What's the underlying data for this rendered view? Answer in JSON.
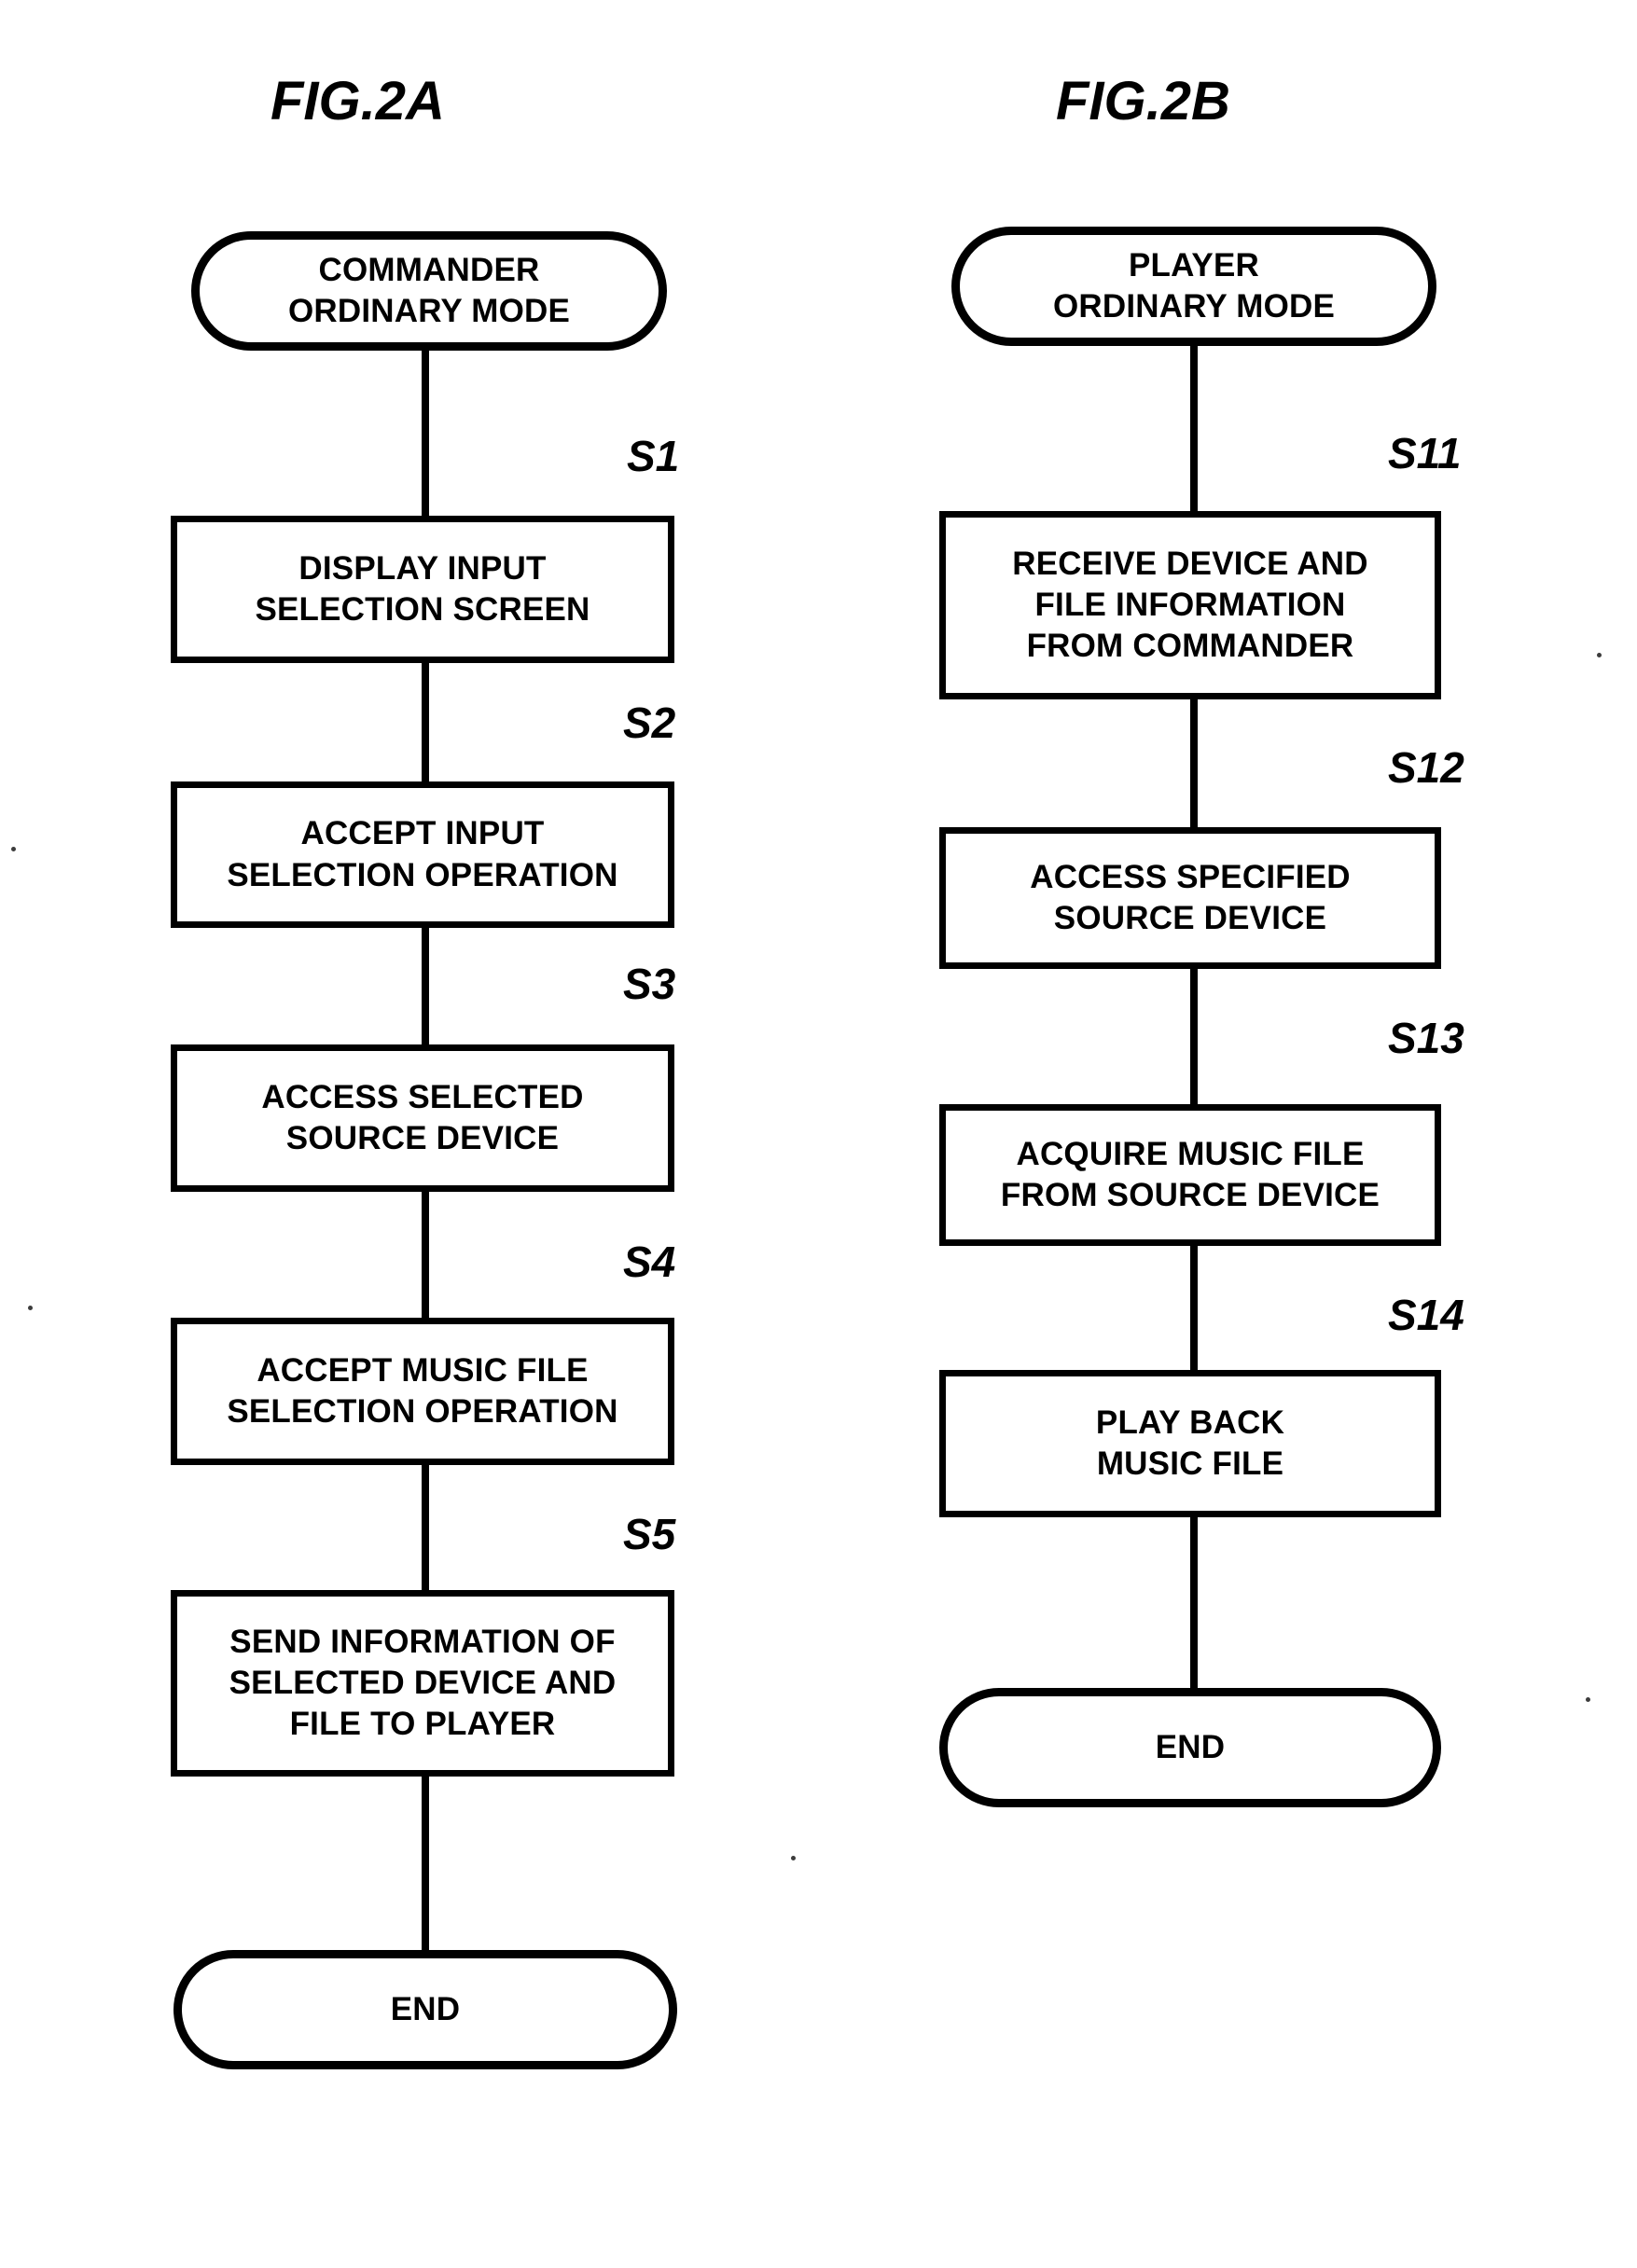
{
  "figures": [
    {
      "id": "fig-a",
      "title": "FIG.2A",
      "start": {
        "label": "COMMANDER\nORDINARY MODE",
        "lines": [
          "COMMANDER",
          "ORDINARY MODE"
        ]
      },
      "end": {
        "label": "END",
        "lines": [
          "END"
        ]
      },
      "steps": [
        {
          "tag": "S1",
          "lines": [
            "DISPLAY INPUT",
            "SELECTION SCREEN"
          ]
        },
        {
          "tag": "S2",
          "lines": [
            "ACCEPT INPUT",
            "SELECTION OPERATION"
          ]
        },
        {
          "tag": "S3",
          "lines": [
            "ACCESS SELECTED",
            "SOURCE DEVICE"
          ]
        },
        {
          "tag": "S4",
          "lines": [
            "ACCEPT MUSIC FILE",
            "SELECTION OPERATION"
          ]
        },
        {
          "tag": "S5",
          "lines": [
            "SEND INFORMATION OF",
            "SELECTED DEVICE AND",
            "FILE TO PLAYER"
          ]
        }
      ]
    },
    {
      "id": "fig-b",
      "title": "FIG.2B",
      "start": {
        "label": "PLAYER\nORDINARY MODE",
        "lines": [
          "PLAYER",
          "ORDINARY MODE"
        ]
      },
      "end": {
        "label": "END",
        "lines": [
          "END"
        ]
      },
      "steps": [
        {
          "tag": "S11",
          "lines": [
            "RECEIVE DEVICE AND",
            "FILE INFORMATION",
            "FROM COMMANDER"
          ]
        },
        {
          "tag": "S12",
          "lines": [
            "ACCESS SPECIFIED",
            "SOURCE DEVICE"
          ]
        },
        {
          "tag": "S13",
          "lines": [
            "ACQUIRE MUSIC FILE",
            "FROM SOURCE DEVICE"
          ]
        },
        {
          "tag": "S14",
          "lines": [
            "PLAY BACK",
            "MUSIC FILE"
          ]
        }
      ]
    }
  ],
  "colors": {
    "ink": "#000000",
    "paper": "#ffffff"
  }
}
